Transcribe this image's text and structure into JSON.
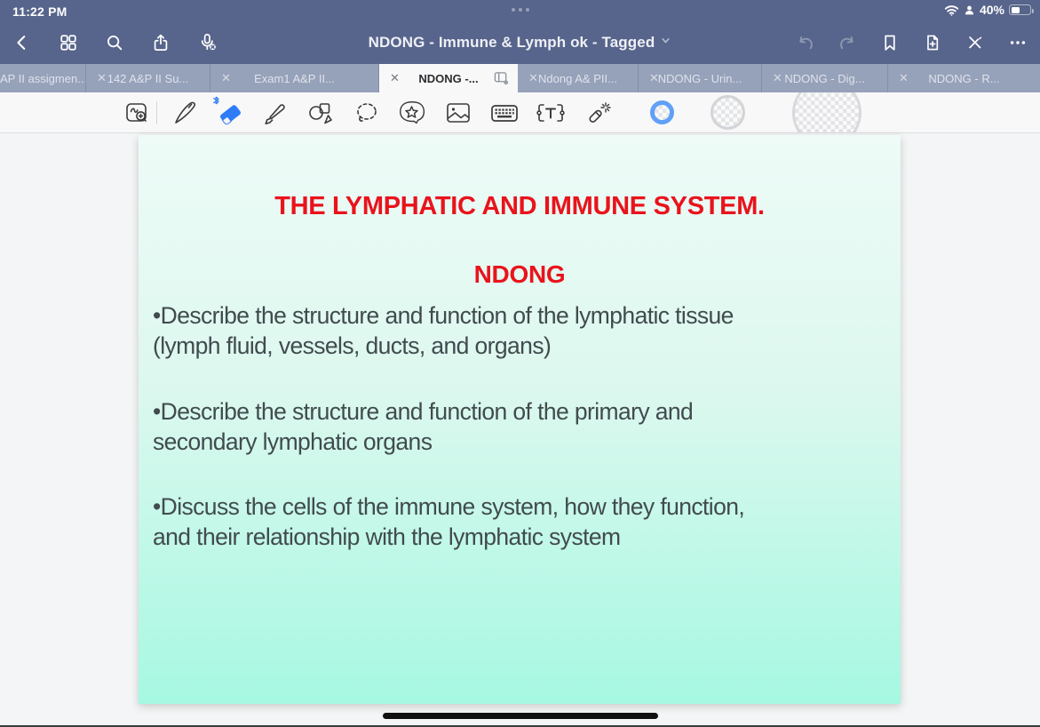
{
  "status_bar": {
    "time": "11:22 PM",
    "battery_percent": "40%",
    "icons": [
      "wifi-icon",
      "person-icon",
      "battery-icon"
    ]
  },
  "nav_bar": {
    "title": "NDONG - Immune & Lymph ok - Tagged",
    "left_icons": [
      "back-chevron-icon",
      "thumbnails-grid-icon",
      "search-icon",
      "share-icon",
      "mic-disabled-icon"
    ],
    "right_icons": [
      "undo-icon",
      "redo-icon",
      "bookmark-icon",
      "add-page-icon",
      "edit-mode-toggle-icon",
      "more-icon"
    ]
  },
  "tab_bar": {
    "tabs": [
      {
        "label": "AP II assigmen...",
        "active": false
      },
      {
        "label": "142 A&P II Su...",
        "active": false
      },
      {
        "label": "Exam1 A&P II...",
        "active": false
      },
      {
        "label": "NDONG -...",
        "active": true
      },
      {
        "label": "Ndong A& PII...",
        "active": false
      },
      {
        "label": "NDONG - Urin...",
        "active": false
      },
      {
        "label": "NDONG - Dig...",
        "active": false
      },
      {
        "label": "NDONG - R...",
        "active": false
      }
    ],
    "close_glyph": "✕"
  },
  "toolbar": {
    "tools": [
      "zoom-window",
      "pen",
      "eraser",
      "highlighter",
      "shapes",
      "lasso",
      "stickers",
      "image",
      "keyboard",
      "text",
      "laser-pointer"
    ],
    "active_tool": "eraser",
    "eraser_accent": "#2F7CF6",
    "thickness_swatches": [
      {
        "size": "small",
        "selected": true,
        "ring_color": "#60A0F7"
      },
      {
        "size": "medium",
        "selected": false,
        "ring_color": "#D3D4D7"
      },
      {
        "size": "large",
        "selected": false,
        "ring_color": "#D8D9DC"
      }
    ]
  },
  "page": {
    "title": "THE LYMPHATIC AND IMMUNE SYSTEM.",
    "subtitle": "NDONG",
    "bullets": [
      {
        "lines": [
          "•Describe the structure and function of the lymphatic tissue",
          "(lymph fluid, vessels, ducts, and organs)"
        ]
      },
      {
        "lines": [
          "•Describe the structure and function of the primary and",
          "secondary lymphatic organs"
        ]
      },
      {
        "lines": [
          "•Discuss the cells of the immune system, how they function,",
          "and their relationship with the lymphatic system"
        ]
      }
    ],
    "colors": {
      "heading": "#E9131C",
      "body": "#414B4E",
      "page_gradient_top": "#EEFBF7",
      "page_gradient_bottom": "#A6F8E2"
    }
  }
}
